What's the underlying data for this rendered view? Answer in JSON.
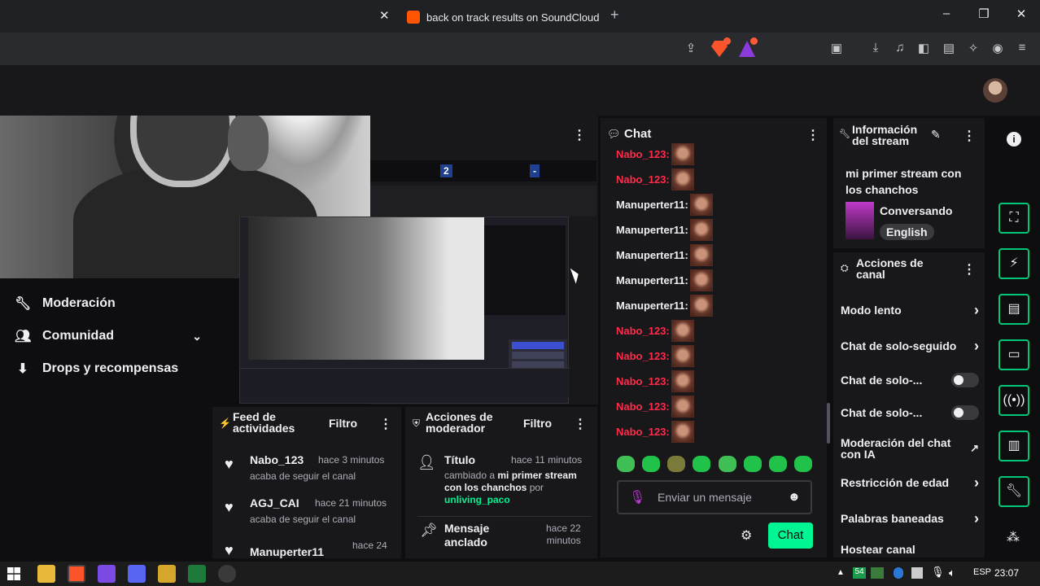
{
  "browser": {
    "tab_title": "back on track results on SoundCloud",
    "tab_close": "✕",
    "new_tab": "+",
    "win_min": "–",
    "win_max": "❐",
    "win_close": "✕"
  },
  "sidebar": {
    "items": [
      {
        "label": "Moderación",
        "icon": "wrench-icon"
      },
      {
        "label": "Comunidad",
        "icon": "community-icon"
      },
      {
        "label": "Drops y recompensas",
        "icon": "drops-icon"
      }
    ]
  },
  "preview": {
    "stats": [
      "2",
      "-"
    ]
  },
  "feed": {
    "title_line1": "Feed de",
    "title_line2": "actividades",
    "filter": "Filtro",
    "events": [
      {
        "name": "Nabo_123",
        "time": "hace 3 minutos",
        "desc": "acaba de seguir el canal"
      },
      {
        "name": "AGJ_CAI",
        "time": "hace 21 minutos",
        "desc": "acaba de seguir el canal"
      },
      {
        "name": "Manuperter11",
        "time": "hace 24",
        "desc": ""
      }
    ]
  },
  "mod_actions": {
    "title_line1": "Acciones de",
    "title_line2": "moderador",
    "filter": "Filtro",
    "items": [
      {
        "title": "Título",
        "time": "hace 11 minutos",
        "desc_prefix": "cambiado a",
        "desc_value": "mi primer stream con los chanchos",
        "desc_by": "por",
        "user": "unliving_paco"
      },
      {
        "title_line1": "Mensaje",
        "title_line2": "anclado",
        "time_line1": "hace 22",
        "time_line2": "minutos"
      }
    ]
  },
  "chat": {
    "title": "Chat",
    "messages": [
      {
        "user": "Nabo_123:",
        "color": "#ff2b4b"
      },
      {
        "user": "Nabo_123:",
        "color": "#ff2b4b"
      },
      {
        "user": "Manuperter11:",
        "color": "#efeff1"
      },
      {
        "user": "Manuperter11:",
        "color": "#efeff1"
      },
      {
        "user": "Manuperter11:",
        "color": "#efeff1"
      },
      {
        "user": "Manuperter11:",
        "color": "#efeff1"
      },
      {
        "user": "Manuperter11:",
        "color": "#efeff1"
      },
      {
        "user": "Nabo_123:",
        "color": "#ff2b4b"
      },
      {
        "user": "Nabo_123:",
        "color": "#ff2b4b"
      },
      {
        "user": "Nabo_123:",
        "color": "#ff2b4b"
      },
      {
        "user": "Nabo_123:",
        "color": "#ff2b4b"
      },
      {
        "user": "Nabo_123:",
        "color": "#ff2b4b"
      }
    ],
    "input_placeholder": "Enviar un mensaje",
    "send_label": "Chat"
  },
  "stream_info": {
    "title_line1": "Información",
    "title_line2": "del stream",
    "stream_title": "mi primer stream con los chanchos",
    "category": "Conversando",
    "language": "English"
  },
  "channel_actions": {
    "title_line1": "Acciones de",
    "title_line2": "canal",
    "items": [
      {
        "label": "Modo lento",
        "control": "chevron"
      },
      {
        "label": "Chat de solo-seguido",
        "control": "chevron"
      },
      {
        "label": "Chat de solo-...",
        "control": "toggle"
      },
      {
        "label": "Chat de solo-...",
        "control": "toggle"
      },
      {
        "label": "Moderación del chat con IA",
        "control": "external"
      },
      {
        "label": "Restricción de edad",
        "control": "chevron"
      },
      {
        "label": "Palabras baneadas",
        "control": "chevron"
      },
      {
        "label": "Hostear canal",
        "control": "none"
      }
    ]
  },
  "taskbar": {
    "lang": "ESP",
    "time": "23:07"
  },
  "colors": {
    "accent_green": "#00f593",
    "twitch_bg": "#18181b",
    "name_red": "#ff2b4b"
  }
}
